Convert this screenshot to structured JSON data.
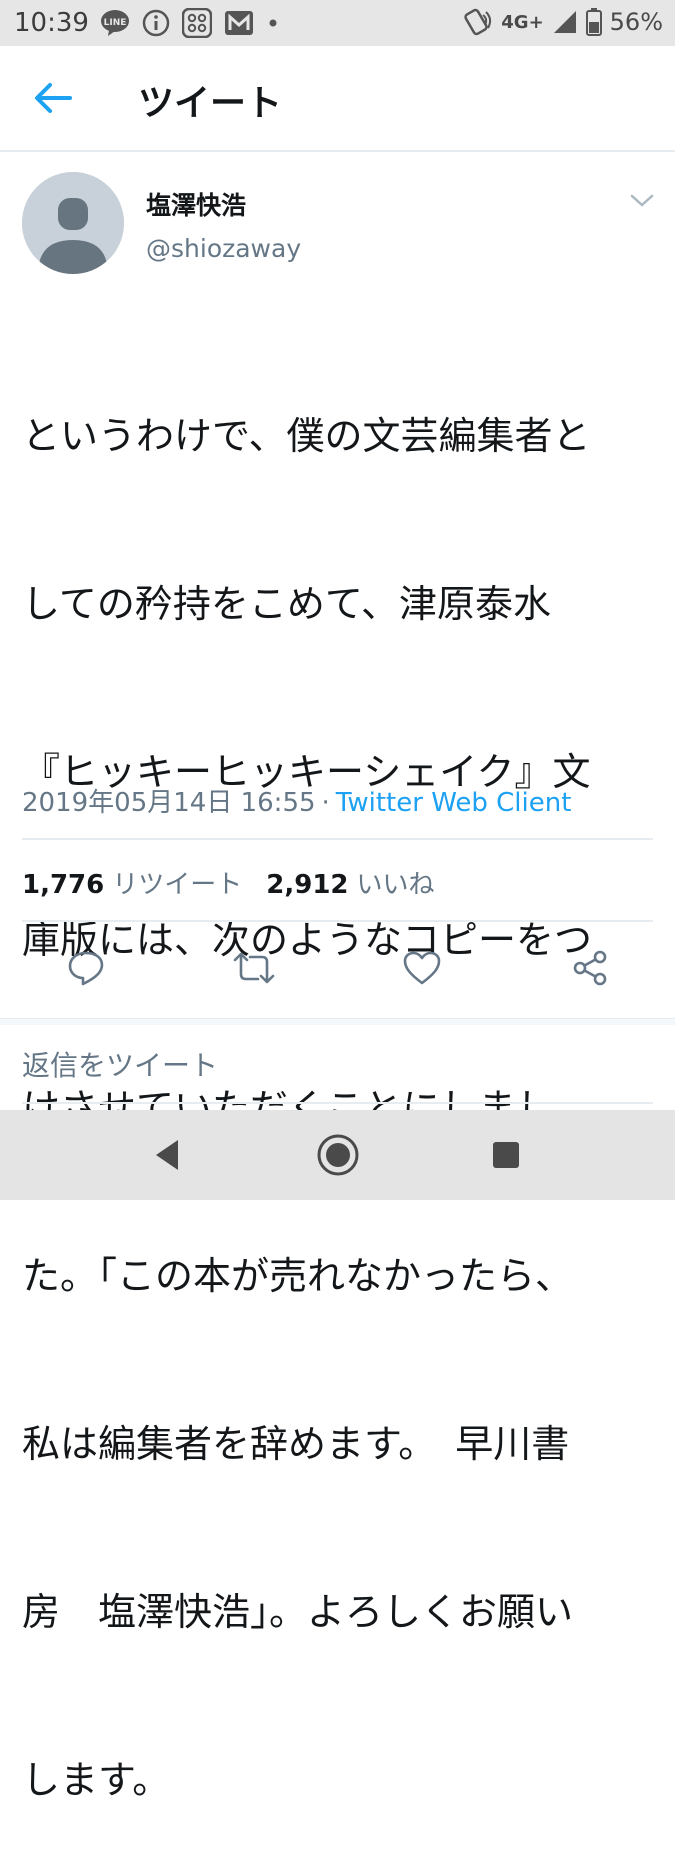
{
  "status_bar": {
    "time": "10:39",
    "network": "4G+",
    "battery": "56%",
    "icons_left": [
      "line-icon",
      "info-icon",
      "apps-grid-icon",
      "mail-m-icon",
      "dot-icon"
    ],
    "icons_right": [
      "nfc-icon",
      "signal-icon",
      "battery-icon"
    ]
  },
  "app_bar": {
    "title": "ツイート",
    "back_icon": "arrow-left-icon"
  },
  "tweet": {
    "display_name": "塩澤快浩",
    "handle": "@shiozaway",
    "lines": [
      "というわけで、僕の文芸編集者と",
      "しての矜持をこめて、津原泰水",
      "『ヒッキーヒッキーシェイク』文",
      "庫版には、次のようなコピーをつ",
      "けさせていただくことにしまし",
      "た。「この本が売れなかったら、",
      "私は編集者を辞めます。　早川書",
      "房　塩澤快浩」。よろしくお願い",
      "します。"
    ],
    "timestamp": "2019年05月14日 16:55",
    "separator": "·",
    "client": "Twitter Web Client",
    "retweet_count": "1,776",
    "retweet_label": "リツイート",
    "like_count": "2,912",
    "like_label": "いいね"
  },
  "actions": [
    "reply-icon",
    "retweet-icon",
    "like-icon",
    "share-icon"
  ],
  "reply": {
    "placeholder": "返信をツイート"
  },
  "colors": {
    "accent": "#1da1f2",
    "secondary_text": "#657786",
    "primary_text": "#14171a",
    "divider": "#e6ecf0"
  }
}
